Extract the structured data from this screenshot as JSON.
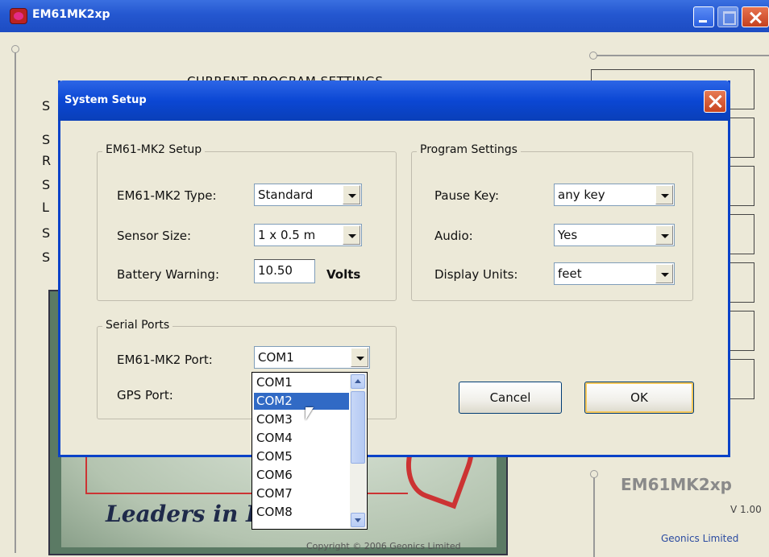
{
  "main_window": {
    "title": "EM61MK2xp",
    "heading": "CURRENT PROGRAM SETTINGS",
    "bg_letters": [
      "S",
      "S",
      "R",
      "S",
      "L",
      "S",
      "S"
    ],
    "splash": {
      "tagline": "Leaders in Ele          ics",
      "copyright": "Copyright © 2006 Geonics Limited"
    },
    "info": {
      "product": "EM61MK2xp",
      "version": "V 1.00",
      "company": "Geonics Limited"
    }
  },
  "dialog": {
    "title": "System Setup",
    "em61_group": {
      "title": "EM61-MK2 Setup",
      "type_label": "EM61-MK2 Type:",
      "type_value": "Standard",
      "sensor_label": "Sensor Size:",
      "sensor_value": "1 x 0.5 m",
      "battery_label": "Battery Warning:",
      "battery_value": "10.50",
      "battery_unit": "Volts"
    },
    "program_group": {
      "title": "Program Settings",
      "pause_label": "Pause Key:",
      "pause_value": "any key",
      "audio_label": "Audio:",
      "audio_value": "Yes",
      "units_label": "Display Units:",
      "units_value": "feet"
    },
    "serial_group": {
      "title": "Serial Ports",
      "em61_port_label": "EM61-MK2 Port:",
      "em61_port_value": "COM1",
      "gps_port_label": "GPS Port:"
    },
    "dropdown_options": [
      "COM1",
      "COM2",
      "COM3",
      "COM4",
      "COM5",
      "COM6",
      "COM7",
      "COM8"
    ],
    "dropdown_selected": "COM2",
    "buttons": {
      "cancel": "Cancel",
      "ok": "OK"
    }
  }
}
